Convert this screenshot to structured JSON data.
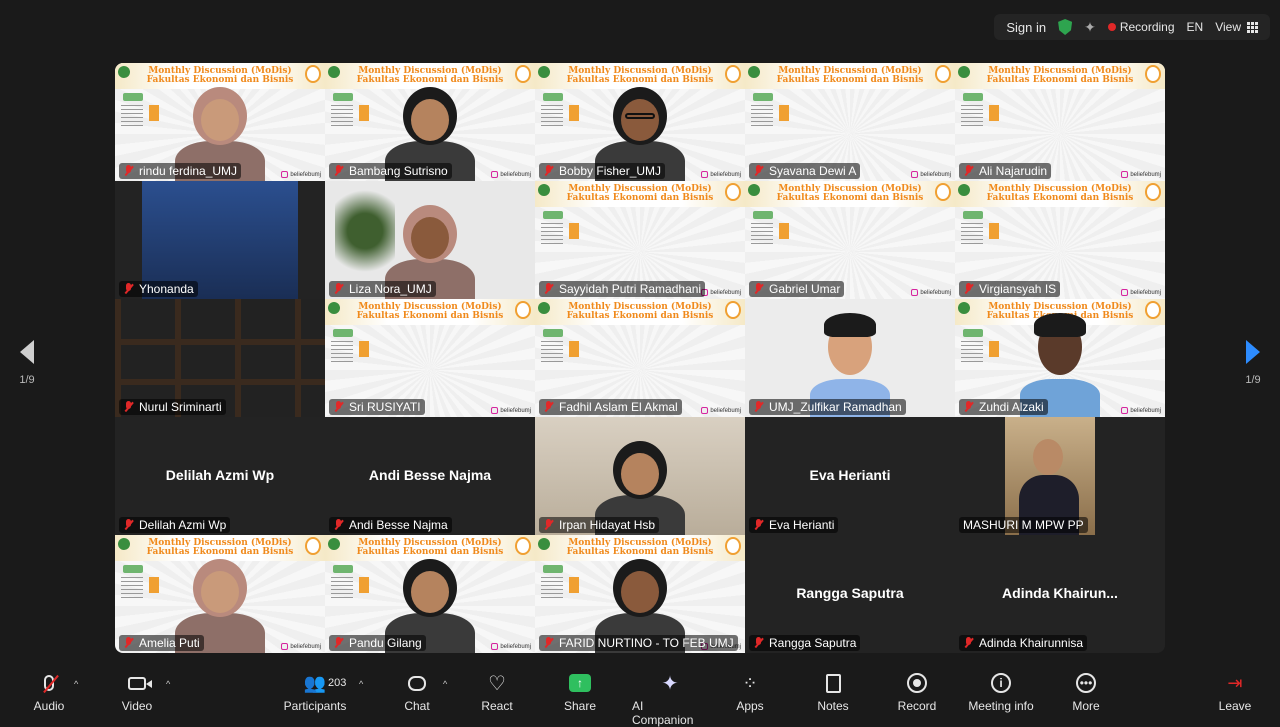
{
  "topbar": {
    "signin": "Sign in",
    "recording": "Recording",
    "language": "EN",
    "view": "View"
  },
  "banner": {
    "title1": "Monthly Discussion (MoDis)",
    "title2": "Fakultas Ekonomi dan Bisnis",
    "social": "beliefebumj"
  },
  "nav": {
    "prev_page": "1/9",
    "next_page": "1/9"
  },
  "participants": [
    {
      "name": "rindu ferdina_UMJ",
      "video": "banner-person",
      "avatar": "hijab"
    },
    {
      "name": "Bambang Sutrisno",
      "video": "banner-person",
      "avatar": "man"
    },
    {
      "name": "Bobby Fisher_UMJ",
      "video": "banner-person",
      "avatar": "man-glasses"
    },
    {
      "name": "Syavana Dewi A",
      "video": "banner"
    },
    {
      "name": "Ali Najarudin",
      "video": "banner"
    },
    {
      "name": "Yhonanda",
      "video": "screen"
    },
    {
      "name": "Liza Nora_UMJ",
      "video": "room-person",
      "avatar": "hijab"
    },
    {
      "name": "Sayyidah Putri Ramadhani",
      "video": "banner"
    },
    {
      "name": "Gabriel Umar",
      "video": "banner"
    },
    {
      "name": "Virgiansyah IS",
      "video": "banner"
    },
    {
      "name": "Nurul Sriminarti",
      "video": "shelf"
    },
    {
      "name": "Sri RUSIYATI",
      "video": "banner"
    },
    {
      "name": "Fadhil Aslam El Akmal",
      "video": "banner"
    },
    {
      "name": "UMJ_Zulfikar Ramadhan",
      "video": "avatar3d"
    },
    {
      "name": "Zuhdi Alzaki",
      "video": "banner-avatar3d"
    },
    {
      "name": "Delilah Azmi Wp",
      "video": "off"
    },
    {
      "name": "Andi Besse Najma",
      "video": "off"
    },
    {
      "name": "Irpan Hidayat Hsb",
      "video": "office-person"
    },
    {
      "name": "Eva Herianti",
      "video": "off"
    },
    {
      "name": "MASHURI M MPW PP",
      "video": "portrait"
    },
    {
      "name": "Amelia Puti",
      "video": "banner-person",
      "avatar": "hijab"
    },
    {
      "name": "Pandu Gilang",
      "video": "banner-person",
      "avatar": "man"
    },
    {
      "name": "FARID NURTINO - TO FEB UMJ",
      "video": "banner-person",
      "avatar": "man"
    },
    {
      "name": "Rangga Saputra",
      "video": "off"
    },
    {
      "name": "Adinda  Khairun...",
      "name_bar": "Adinda Khairunnisa",
      "video": "off"
    }
  ],
  "toolbar": {
    "audio": "Audio",
    "video": "Video",
    "participants": "Participants",
    "participant_count": "203",
    "chat": "Chat",
    "react": "React",
    "share": "Share",
    "ai_companion": "AI Companion",
    "apps": "Apps",
    "notes": "Notes",
    "record": "Record",
    "meeting_info": "Meeting info",
    "more": "More",
    "leave": "Leave"
  },
  "colors": {
    "active_speaker": "#2fd572",
    "mute": "#e02828",
    "share": "#2fbf5f",
    "next_arrow": "#2d8cff"
  }
}
